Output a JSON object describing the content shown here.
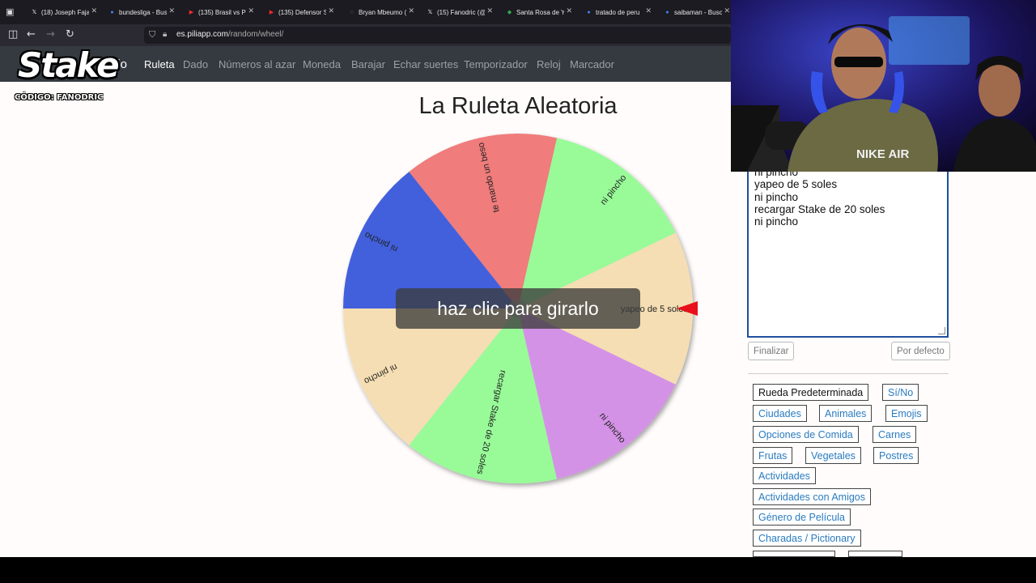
{
  "browser": {
    "tabs": [
      {
        "title": "(18) Joseph Fajar",
        "icon": "x-icon"
      },
      {
        "title": "bundesliga - Busc",
        "icon": "google-icon"
      },
      {
        "title": "(135) Brasil vs Pe",
        "icon": "youtube-icon"
      },
      {
        "title": "(135) Defensor S",
        "icon": "youtube-icon"
      },
      {
        "title": "Bryan Mbeumo (",
        "icon": "generic-icon"
      },
      {
        "title": "(15) Fanodric (@",
        "icon": "x-icon"
      },
      {
        "title": "Santa Rosa de Ya",
        "icon": "maps-icon"
      },
      {
        "title": "tratado de peru",
        "icon": "google-icon"
      },
      {
        "title": "saibaman - Busc",
        "icon": "google-icon"
      }
    ],
    "url_domain": "es.piliapp.com",
    "url_path": "/random/wheel/"
  },
  "overlay_logo": {
    "word": "Stake",
    "code": "CÓDIGO: FANODRIC"
  },
  "site": {
    "brand": "Inicio",
    "nav": [
      {
        "label": "Ruleta",
        "active": true
      },
      {
        "label": "Dado",
        "active": false
      },
      {
        "label": "Números al azar",
        "active": false
      },
      {
        "label": "Moneda",
        "active": false
      },
      {
        "label": "Barajar",
        "active": false
      },
      {
        "label": "Echar suertes",
        "active": false
      },
      {
        "label": "Temporizador",
        "active": false
      },
      {
        "label": "Reloj",
        "active": false
      },
      {
        "label": "Marcador",
        "active": false
      }
    ]
  },
  "page": {
    "title": "La Ruleta Aleatoria",
    "spin_prompt": "haz clic para girarlo"
  },
  "wheel": {
    "pointer_color": "#e8101a",
    "segments": [
      {
        "label": "yapeo de 5 soles",
        "color": "#f5deb3"
      },
      {
        "label": "ni pincho",
        "color": "#d492e6"
      },
      {
        "label": "recargar Stake de 20 soles",
        "color": "#98fb98"
      },
      {
        "label": "ni pincho",
        "color": "#f5deb3"
      },
      {
        "label": "ni pincho",
        "color": "#4361dc"
      },
      {
        "label": "te mando un beso",
        "color": "#f07b7b"
      },
      {
        "label": "ni pincho",
        "color": "#98fb98"
      }
    ]
  },
  "options_panel": {
    "textarea_lines": [
      "ni pincho",
      "yapeo de 5 soles",
      "ni pincho",
      "recargar Stake de 20 soles",
      "ni pincho"
    ],
    "finish_label": "Finalizar",
    "default_label": "Por defecto",
    "presets": [
      {
        "label": "Rueda Predeterminada",
        "selected": true
      },
      {
        "label": "Sí/No"
      },
      {
        "label": "Ciudades"
      },
      {
        "label": "Animales"
      },
      {
        "label": "Emojis"
      },
      {
        "label": "Opciones de Comida"
      },
      {
        "label": "Carnes"
      },
      {
        "label": "Frutas"
      },
      {
        "label": "Vegetales"
      },
      {
        "label": "Postres"
      },
      {
        "label": "Actividades"
      },
      {
        "label": "Actividades con Amigos"
      },
      {
        "label": "Género de Película"
      },
      {
        "label": "Charadas / Pictionary"
      }
    ]
  },
  "webcam": {
    "shirt_text": "NIKE AIR"
  }
}
